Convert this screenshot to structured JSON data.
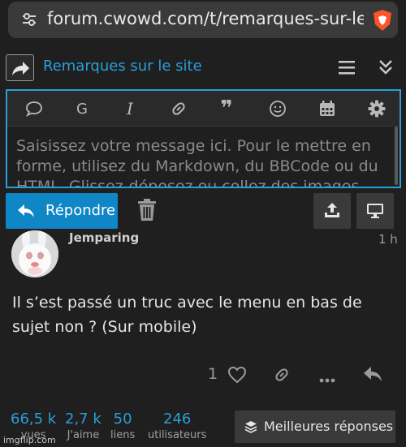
{
  "browser": {
    "url": "forum.cwowd.com/t/remarques-sur-le-site"
  },
  "composer": {
    "topic_title": "Remarques sur le site",
    "placeholder": "Saisissez votre message ici. Pour le mettre en forme, utilisez du Markdown, du BBCode ou du HTML. Glissez-déposez ou collez des images.",
    "toolbar_items": [
      "quote-icon",
      "grid-g-icon",
      "italic-icon",
      "link-icon",
      "blockquote-icon",
      "emoji-icon",
      "calendar-icon",
      "gear-icon"
    ],
    "toolbar_g": "G",
    "toolbar_i": "I",
    "toolbar_quote": "❞",
    "reply_label": "Répondre"
  },
  "post": {
    "username": "Jemparing",
    "time": "1 h",
    "text": "Il s’est passé un truc avec le menu en bas de sujet non ? (Sur mobile)",
    "likes": "1"
  },
  "stats": [
    {
      "num": "66,5 k",
      "label": "vues"
    },
    {
      "num": "2,7 k",
      "label": "J'aime"
    },
    {
      "num": "50",
      "label": "liens"
    },
    {
      "num": "246",
      "label": "utilisateurs"
    }
  ],
  "best_label": "Meilleures réponses",
  "watermark": "imgflip.com",
  "colors": {
    "accent": "#2a9fd8",
    "button_primary": "#0f87c7",
    "background": "#1f1f1f"
  }
}
